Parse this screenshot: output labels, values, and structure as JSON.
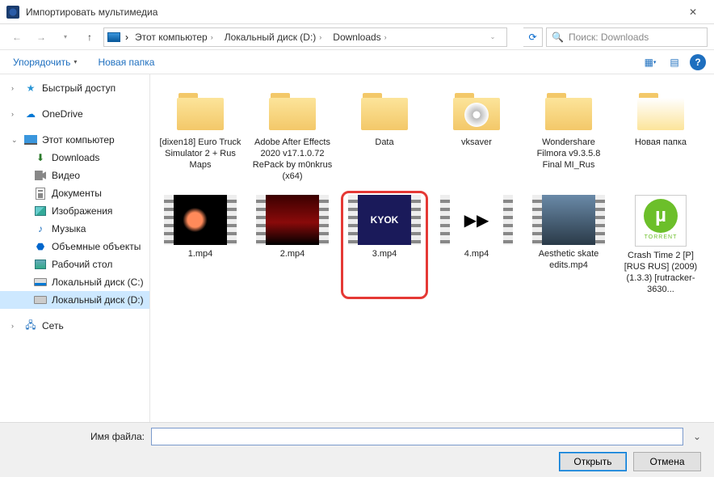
{
  "titlebar": {
    "title": "Импортировать мультимедиа"
  },
  "breadcrumb": {
    "parts": [
      "Этот компьютер",
      "Локальный диск (D:)",
      "Downloads"
    ],
    "search_placeholder": "Поиск: Downloads"
  },
  "toolbar": {
    "organize": "Упорядочить",
    "newfolder": "Новая папка"
  },
  "sidebar": {
    "quick": "Быстрый доступ",
    "onedrive": "OneDrive",
    "thispc": "Этот компьютер",
    "children": {
      "downloads": "Downloads",
      "video": "Видео",
      "documents": "Документы",
      "pictures": "Изображения",
      "music": "Музыка",
      "objects3d": "Объемные объекты",
      "desktop": "Рабочий стол",
      "drive_c": "Локальный диск (C:)",
      "drive_d": "Локальный диск (D:)"
    },
    "network": "Сеть"
  },
  "files": [
    {
      "kind": "folder",
      "label": "[dixen18] Euro Truck Simulator 2 + Rus Maps"
    },
    {
      "kind": "folder",
      "label": "Adobe After Effects 2020 v17.1.0.72 RePack by m0nkrus (x64)"
    },
    {
      "kind": "folder",
      "label": "Data"
    },
    {
      "kind": "folder-disc",
      "label": "vksaver"
    },
    {
      "kind": "folder",
      "label": "Wondershare Filmora v9.3.5.8 Final MI_Rus"
    },
    {
      "kind": "folder-open",
      "label": "Новая папка"
    },
    {
      "kind": "video",
      "thumb": "film-1",
      "label": "1.mp4"
    },
    {
      "kind": "video",
      "thumb": "film-2",
      "label": "2.mp4"
    },
    {
      "kind": "video",
      "thumb": "film-3",
      "label": "3.mp4",
      "highlighted": true,
      "text": "KYOK"
    },
    {
      "kind": "video",
      "thumb": "film-4",
      "label": "4.mp4"
    },
    {
      "kind": "video",
      "thumb": "film-5",
      "label": "Aesthetic skate edits.mp4"
    },
    {
      "kind": "torrent",
      "label": "Crash Time 2 [P] [RUS RUS] (2009) (1.3.3) [rutracker-3630..."
    }
  ],
  "footer": {
    "fname_label": "Имя файла:",
    "fname_value": "",
    "open": "Открыть",
    "cancel": "Отмена"
  }
}
